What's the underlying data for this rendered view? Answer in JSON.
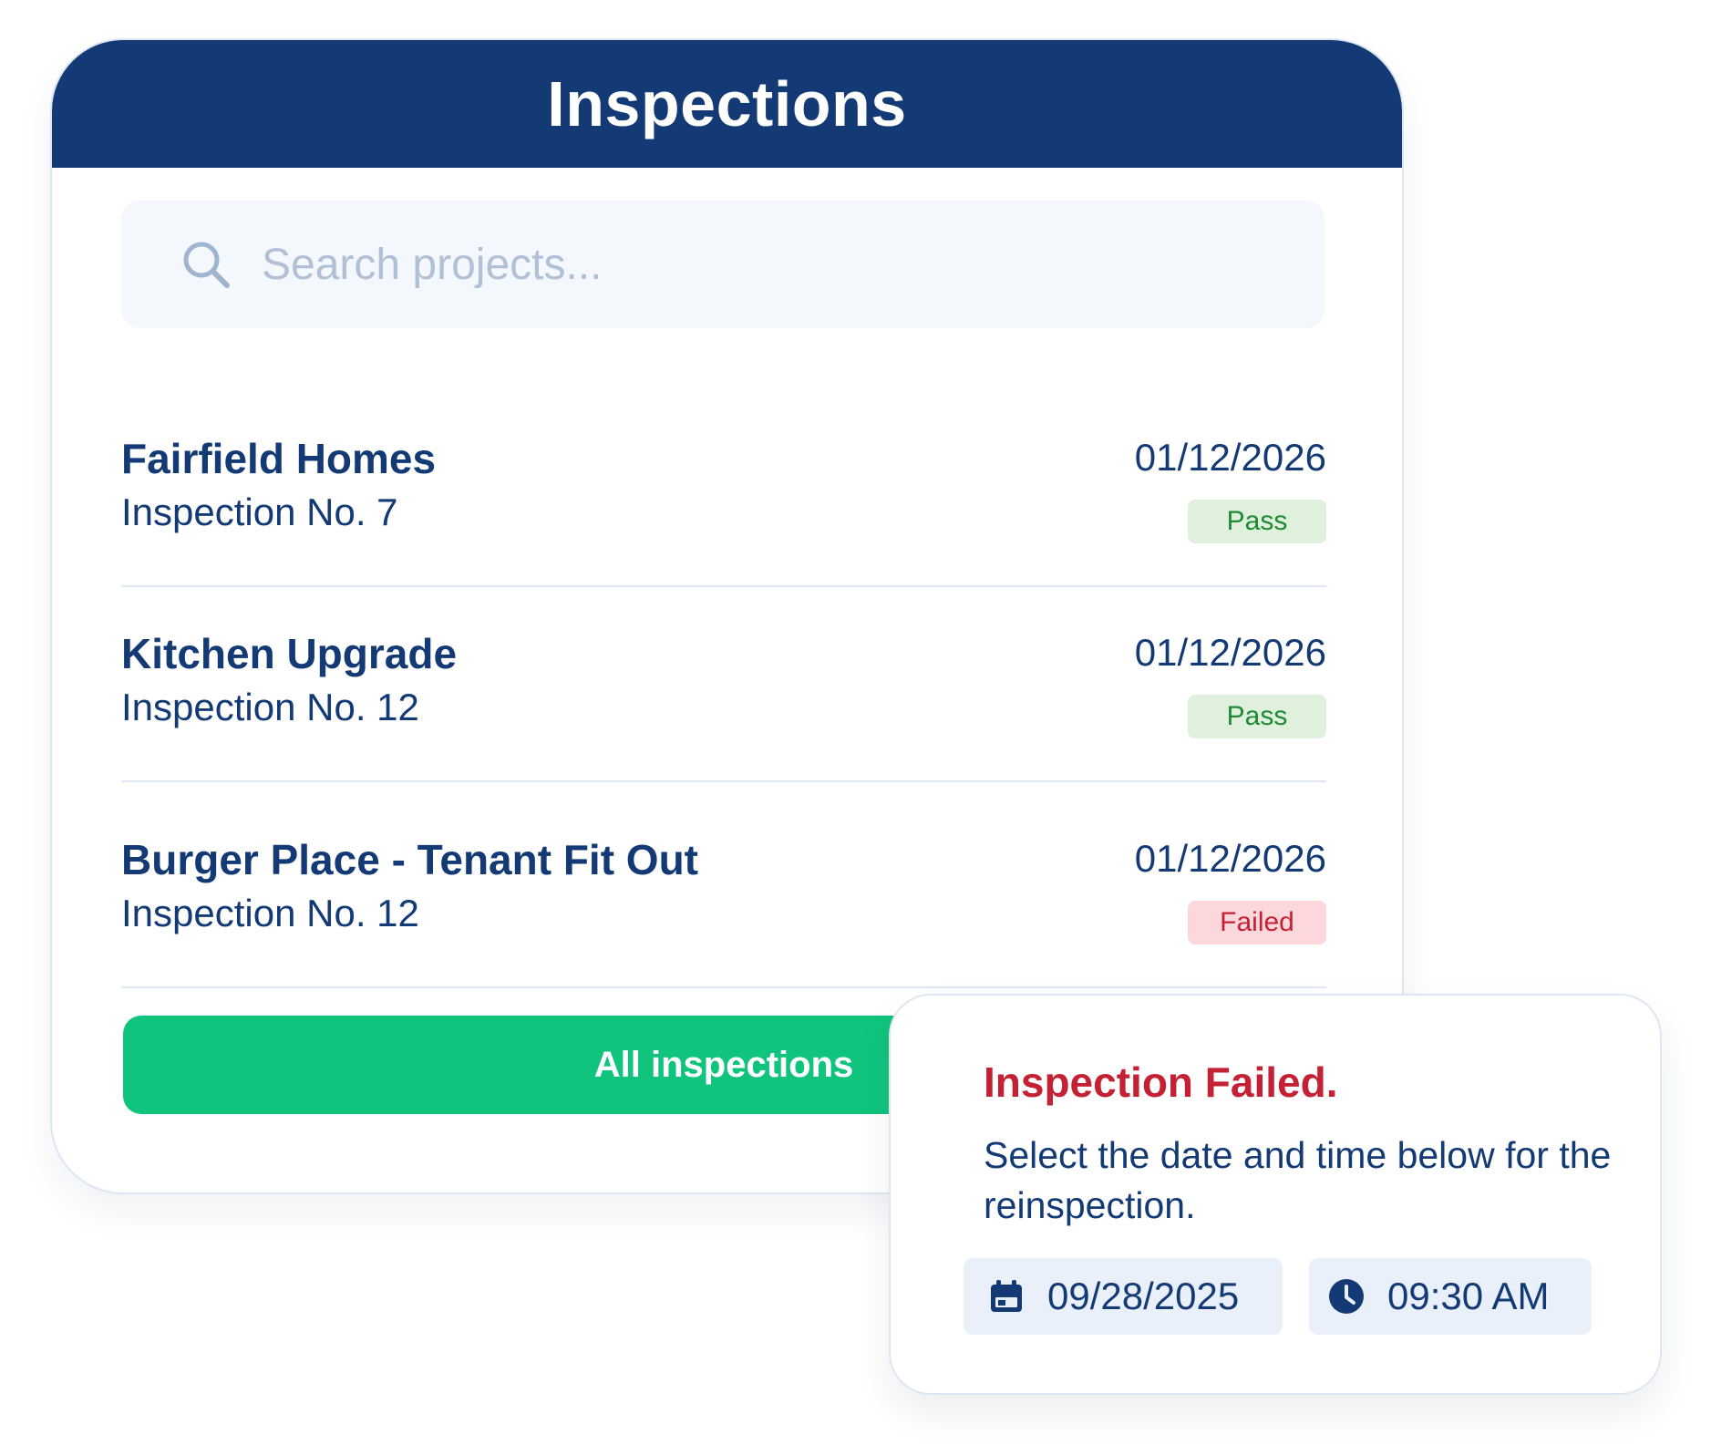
{
  "colors": {
    "header_bg": "#133a75",
    "primary_text": "#133a75",
    "accent_green": "#10c47e",
    "pass_bg": "#dff1dc",
    "pass_text": "#1f8a34",
    "fail_bg": "#fcd7dc",
    "fail_text": "#c42234"
  },
  "header": {
    "title": "Inspections"
  },
  "search": {
    "icon": "search-icon",
    "placeholder": "Search projects..."
  },
  "inspections": [
    {
      "name": "Fairfield Homes",
      "subtitle": "Inspection No. 7",
      "date": "01/12/2026",
      "status": "Pass"
    },
    {
      "name": "Kitchen Upgrade",
      "subtitle": "Inspection No. 12",
      "date": "01/12/2026",
      "status": "Pass"
    },
    {
      "name": "Burger Place - Tenant Fit Out",
      "subtitle": "Inspection No. 12",
      "date": "01/12/2026",
      "status": "Failed"
    }
  ],
  "footer": {
    "all_button_label": "All inspections"
  },
  "popup": {
    "title": "Inspection Failed.",
    "message": "Select the date and time below for the reinspection.",
    "date": {
      "icon": "calendar-icon",
      "value": "09/28/2025"
    },
    "time": {
      "icon": "clock-icon",
      "value": "09:30 AM"
    }
  }
}
